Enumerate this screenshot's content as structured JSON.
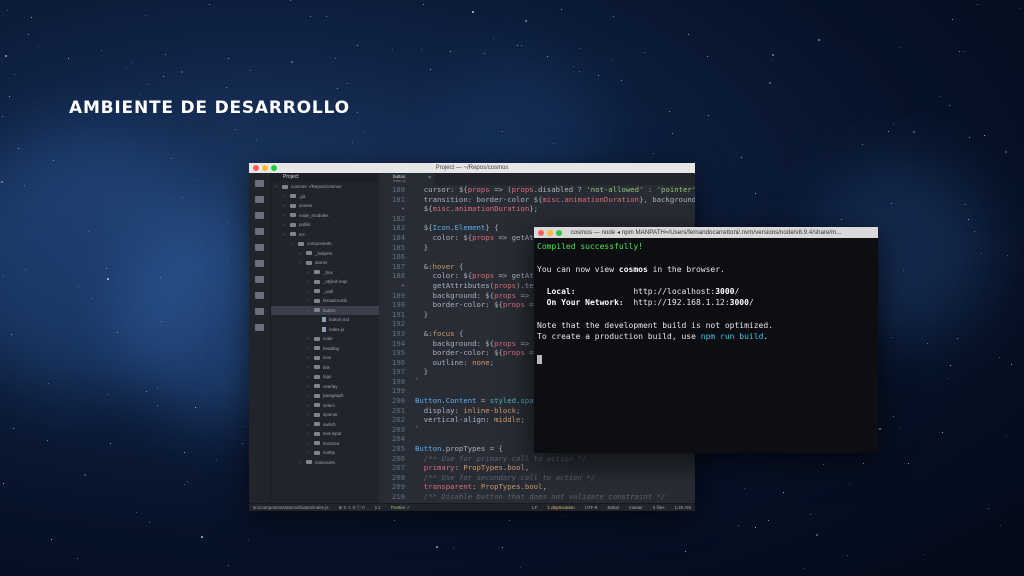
{
  "slide": {
    "title": "AMBIENTE DE DESARROLLO"
  },
  "editor": {
    "window_title": "Project — ~/Repos/cosmos",
    "tab": {
      "label": "button",
      "sublabel": "index.js"
    },
    "tree_header": "Project",
    "tree": [
      {
        "label": "cosmos ~/Repos/cosmos",
        "type": "folder",
        "depth": 0
      },
      {
        "label": ".git",
        "type": "folder",
        "depth": 1
      },
      {
        "label": "assets",
        "type": "folder",
        "depth": 1
      },
      {
        "label": "node_modules",
        "type": "folder",
        "depth": 1
      },
      {
        "label": "public",
        "type": "folder",
        "depth": 1
      },
      {
        "label": "src",
        "type": "folder",
        "depth": 1
      },
      {
        "label": "components",
        "type": "folder",
        "depth": 2
      },
      {
        "label": "_helpers",
        "type": "folder",
        "depth": 3
      },
      {
        "label": "atoms",
        "type": "folder",
        "depth": 3
      },
      {
        "label": "_box",
        "type": "folder",
        "depth": 4
      },
      {
        "label": "_styled-reqs",
        "type": "folder",
        "depth": 4
      },
      {
        "label": "_wall",
        "type": "folder",
        "depth": 4
      },
      {
        "label": "breadcrumb",
        "type": "folder",
        "depth": 4
      },
      {
        "label": "button",
        "type": "folder",
        "depth": 4,
        "selected": true
      },
      {
        "label": "button.md",
        "type": "file",
        "depth": 5
      },
      {
        "label": "index.js",
        "type": "file",
        "depth": 5
      },
      {
        "label": "code",
        "type": "folder",
        "depth": 4
      },
      {
        "label": "heading",
        "type": "folder",
        "depth": 4
      },
      {
        "label": "icon",
        "type": "folder",
        "depth": 4
      },
      {
        "label": "link",
        "type": "folder",
        "depth": 4
      },
      {
        "label": "logo",
        "type": "folder",
        "depth": 4
      },
      {
        "label": "overlay",
        "type": "folder",
        "depth": 4
      },
      {
        "label": "paragraph",
        "type": "folder",
        "depth": 4
      },
      {
        "label": "select",
        "type": "folder",
        "depth": 4
      },
      {
        "label": "spinner",
        "type": "folder",
        "depth": 4
      },
      {
        "label": "switch",
        "type": "folder",
        "depth": 4
      },
      {
        "label": "text-input",
        "type": "folder",
        "depth": 4
      },
      {
        "label": "textarea",
        "type": "folder",
        "depth": 4
      },
      {
        "label": "tooltip",
        "type": "folder",
        "depth": 4
      },
      {
        "label": "molecules",
        "type": "folder",
        "depth": 3
      }
    ],
    "code_lines": [
      {
        "n": "180",
        "html": "  cursor: ${<span class='p'>props</span> => (<span class='p'>props</span>.disabled ? <span class='s'>'not-allowed'</span> : <span class='s'>'pointer'</span>)};"
      },
      {
        "n": "181",
        "html": "  transition: border-color ${<span class='p'>misc</span>.<span class='p'>animationDuration</span>}, background"
      },
      {
        "n": "•",
        "html": "  ${<span class='p'>misc</span>.<span class='p'>animationDuration</span>};"
      },
      {
        "n": "182",
        "html": ""
      },
      {
        "n": "183",
        "html": "  ${<span class='f'>Icon</span>.<span class='f'>Element</span>} {"
      },
      {
        "n": "184",
        "html": "    color: ${<span class='p'>props</span> => getAttribu"
      },
      {
        "n": "185",
        "html": "  }"
      },
      {
        "n": "186",
        "html": ""
      },
      {
        "n": "187",
        "html": "  &amp;:<span class='n'>hover</span> {"
      },
      {
        "n": "188",
        "html": "    color: ${<span class='p'>props</span> => getAttrib"
      },
      {
        "n": "•",
        "html": "    getAttributes(<span class='p'>props</span>).text};"
      },
      {
        "n": "189",
        "html": "    background: ${<span class='p'>props</span> => getA"
      },
      {
        "n": "190",
        "html": "    border-color: ${<span class='p'>props</span> => get"
      },
      {
        "n": "191",
        "html": "  }"
      },
      {
        "n": "192",
        "html": ""
      },
      {
        "n": "193",
        "html": "  &amp;:<span class='n'>focus</span> {"
      },
      {
        "n": "194",
        "html": "    background: ${<span class='p'>props</span> => getA"
      },
      {
        "n": "195",
        "html": "    border-color: ${<span class='p'>props</span> => ge"
      },
      {
        "n": "196",
        "html": "    outline: <span class='n'>none</span>;"
      },
      {
        "n": "197",
        "html": "  }"
      },
      {
        "n": "198",
        "html": "`"
      },
      {
        "n": "199",
        "html": ""
      },
      {
        "n": "200",
        "html": "<span class='f'>Button</span>.<span class='f'>Content</span> = <span class='t'>styled</span>.<span class='t'>span</span>`"
      },
      {
        "n": "201",
        "html": "  display: <span class='n'>inline-block</span>;"
      },
      {
        "n": "202",
        "html": "  vertical-align: <span class='n'>middle</span>;"
      },
      {
        "n": "203",
        "html": "`"
      },
      {
        "n": "204",
        "html": ""
      },
      {
        "n": "205",
        "html": "<span class='f'>Button</span>.propTypes = {"
      },
      {
        "n": "206",
        "html": "  <span class='c'>/** Use for primary call to action */</span>"
      },
      {
        "n": "207",
        "html": "  <span class='p'>primary</span>: <span class='n'>PropTypes</span>.<span class='n'>bool</span>,"
      },
      {
        "n": "208",
        "html": "  <span class='c'>/** Use for secondary call to action */</span>"
      },
      {
        "n": "209",
        "html": "  <span class='p'>transparent</span>: <span class='n'>PropTypes</span>.<span class='n'>bool</span>,"
      },
      {
        "n": "210",
        "html": "  <span class='c'>/** Disable button that does not validate constraint */</span>"
      }
    ],
    "status": {
      "path": "src/components/atoms/button/index.js",
      "counts": "⊗ 0  ⚠ 0  ⓘ 0",
      "position": "1:1",
      "prettier": "Prettier ✓",
      "lf": "LF",
      "deprecation": "1 deprecation",
      "encoding": "UTF-8",
      "lang": "Babel",
      "branch": "master",
      "files": "0 files",
      "time": "1:49 AM"
    }
  },
  "terminal": {
    "title": "cosmos — node ◂ npm MANPATH=/Users/fernandocarrettoni/.nvm/versions/node/v8.9.4/share/m...",
    "compiled": "Compiled successfully!",
    "view_prefix": "You can now view ",
    "app_name": "cosmos",
    "view_suffix": " in the browser.",
    "local_label": "  Local:",
    "local_pad": "            ",
    "local_url_prefix": "http://localhost:",
    "local_port": "3000",
    "local_url_suffix": "/",
    "network_label": "  On Your Network:",
    "network_pad": "  ",
    "network_url_prefix": "http://192.168.1.12:",
    "network_port": "3000",
    "network_url_suffix": "/",
    "note1": "Note that the development build is not optimized.",
    "note2_prefix": "To create a production build, use ",
    "note2_cmd": "npm run build",
    "note2_suffix": "."
  }
}
